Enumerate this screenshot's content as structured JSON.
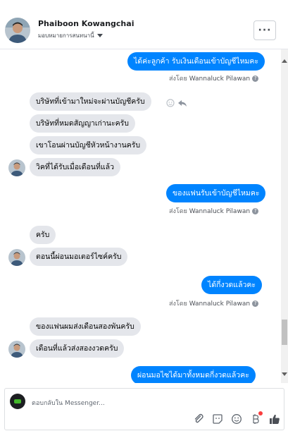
{
  "header": {
    "name": "Phaiboon Kowangchai",
    "assign_label": "มอบหมายการสนทนานี้",
    "more_label": "···"
  },
  "messages": {
    "m1": "ได้ค่ะลูกค้า รับเงินเดือนเข้าบัญชีไหมคะ",
    "m2": "บริษัทที่เข้ามาใหม่จะผ่านบัญชีครับ",
    "m3": "บริษัทที่หมดสัญญาเก่านะครับ",
    "m4": "เขาโอนผ่านบัญชีหัวหน้างานครับ",
    "m5": "วิคที่ได้รับเมื่อเดือนที่แล้ว",
    "m6": "ของแฟนรับเข้าบัญชีไหมคะ",
    "m7": "ครับ",
    "m8": "ตอนนี้ผ่อนมอเตอร์ไซค์ครับ",
    "m9": "ได้กี่งวดแล้วคะ",
    "m10": "ของแฟนผมส่งเดือนสองพันครับ",
    "m11": "เดือนที่แล้วส่งสองงวดครับ",
    "m12": "ผ่อนมอไซได้มาทั้งหมดกี่งวดแล้วคะ"
  },
  "sent_by": {
    "prefix": "ส่งโดย",
    "agent": "Wannaluck Pilawan",
    "help": "?"
  },
  "composer": {
    "placeholder": "ตอบกลับใน Messenger..."
  },
  "icons": {
    "attach": "paperclip-icon",
    "sticker": "sticker-icon",
    "emoji": "emoji-icon",
    "payments": "payments-icon",
    "like": "thumbs-up-icon"
  },
  "colors": {
    "outgoing_bubble": "#0084ff",
    "incoming_bubble": "#e4e6eb",
    "like_icon": "#4b4f56"
  }
}
